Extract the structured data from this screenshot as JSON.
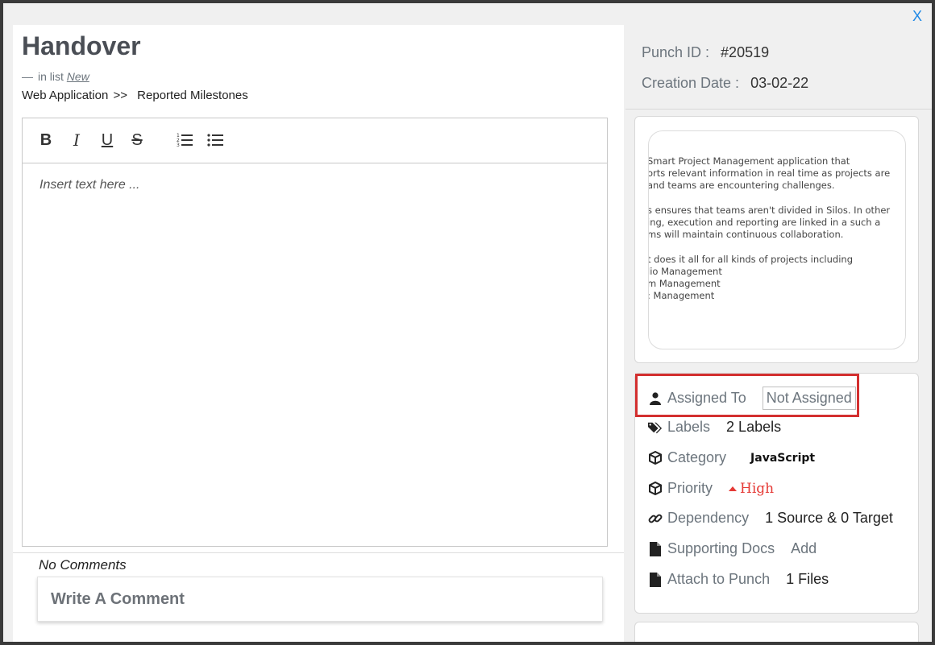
{
  "modal": {
    "close_label": "X"
  },
  "card": {
    "title": "Handover",
    "list_prefix_dash": "—",
    "list_prefix": "in list",
    "list_name": "New",
    "breadcrumb": {
      "project": "Web Application",
      "separator": ">>",
      "section": "Reported Milestones"
    }
  },
  "editor": {
    "toolbar": {
      "bold": "B",
      "italic": "I",
      "underline": "U",
      "strike": "S",
      "ordered_list_icon": "ordered-list-icon",
      "bullet_list_icon": "bullet-list-icon"
    },
    "placeholder": "Insert text here ..."
  },
  "comments": {
    "empty_text": "No Comments",
    "write_placeholder": "Write A Comment"
  },
  "meta": {
    "punch_id_label": "Punch ID :",
    "punch_id_value": "#20519",
    "creation_date_label": "Creation Date :",
    "creation_date_value": "03-02-22"
  },
  "attachment_preview": {
    "lines": [
      "Smart Project Management application that",
      "orts relevant information in real time as projects are",
      "and teams are encountering challenges.",
      "",
      "s ensures that teams aren't divided in Silos. In other",
      "ing, execution and reporting are linked in a such a",
      "ms will maintain continuous collaboration.",
      "",
      "t does it all for all kinds of projects including",
      "lio Management",
      "m Management",
      ": Management"
    ]
  },
  "properties": {
    "assigned_to": {
      "label": "Assigned To",
      "value": "Not Assigned",
      "icon": "user-icon"
    },
    "labels": {
      "label": "Labels",
      "value": "2 Labels",
      "icon": "tags-icon"
    },
    "category": {
      "label": "Category",
      "value": "JavaScript",
      "icon": "cube-icon"
    },
    "priority": {
      "label": "Priority",
      "value": "High",
      "icon": "cube-icon",
      "color": "#e53935"
    },
    "dependency": {
      "label": "Dependency",
      "value": "1 Source & 0 Target",
      "icon": "link-icon"
    },
    "supporting_docs": {
      "label": "Supporting Docs",
      "value": "Add",
      "icon": "file-icon"
    },
    "attach_to_punch": {
      "label": "Attach to Punch",
      "value": "1 Files",
      "icon": "file-icon"
    }
  },
  "colors": {
    "accent_blue": "#1e88e5",
    "highlight_red": "#d32f2f",
    "priority_high": "#e53935"
  }
}
